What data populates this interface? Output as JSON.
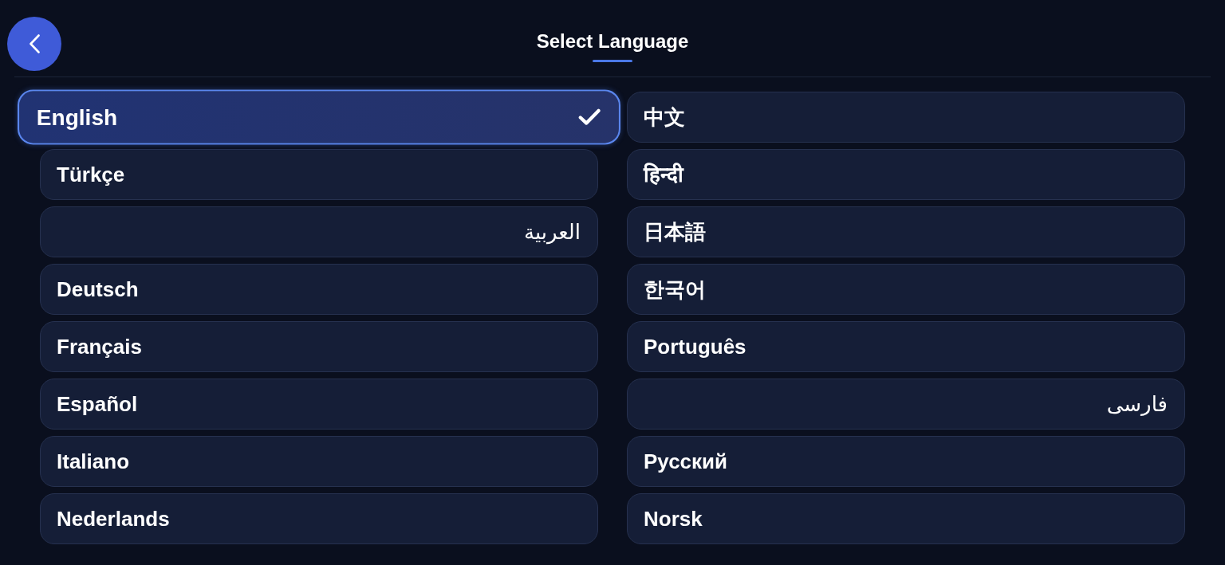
{
  "header": {
    "title": "Select Language"
  },
  "languages": [
    {
      "label": "English",
      "selected": true
    },
    {
      "label": "中文",
      "selected": false
    },
    {
      "label": "Türkçe",
      "selected": false
    },
    {
      "label": "हिन्दी",
      "selected": false
    },
    {
      "label": "العربية",
      "selected": false
    },
    {
      "label": "日本語",
      "selected": false
    },
    {
      "label": "Deutsch",
      "selected": false
    },
    {
      "label": "한국어",
      "selected": false
    },
    {
      "label": "Français",
      "selected": false
    },
    {
      "label": "Português",
      "selected": false
    },
    {
      "label": "Español",
      "selected": false
    },
    {
      "label": "فارسی",
      "selected": false
    },
    {
      "label": "Italiano",
      "selected": false
    },
    {
      "label": "Русский",
      "selected": false
    },
    {
      "label": "Nederlands",
      "selected": false
    },
    {
      "label": "Norsk",
      "selected": false
    }
  ]
}
